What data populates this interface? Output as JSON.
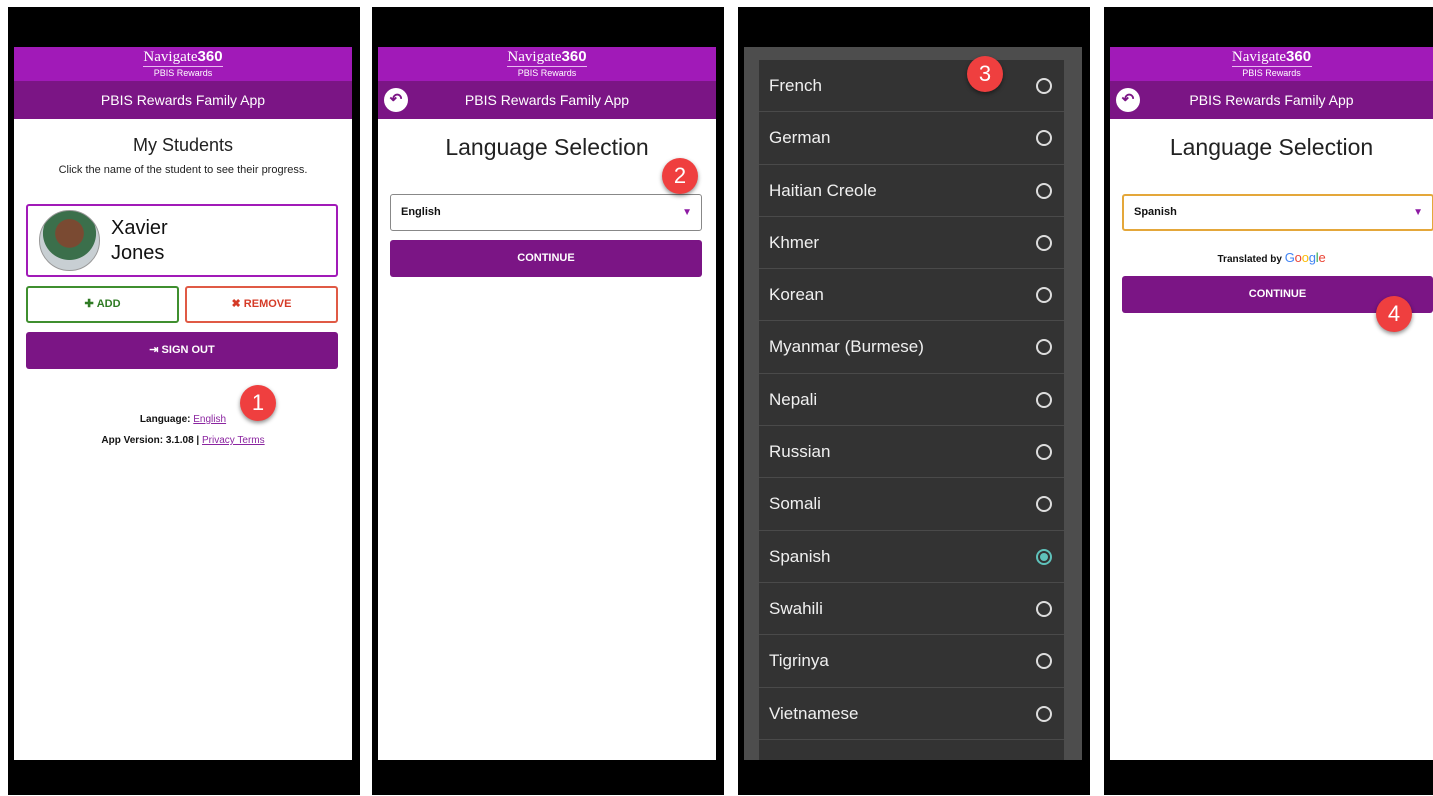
{
  "brand": {
    "name_light": "Navigate",
    "name_bold": "360",
    "subtitle": "PBIS Rewards"
  },
  "app_title": "PBIS Rewards Family App",
  "screen1": {
    "title": "My Students",
    "subtitle": "Click the name of the student to see their progress.",
    "student": {
      "first": "Xavier",
      "last": "Jones"
    },
    "add_label": "ADD",
    "add_icon": "plus-icon",
    "remove_label": "REMOVE",
    "remove_icon": "x-icon",
    "signout_label": "SIGN OUT",
    "signout_icon": "sign-out-icon",
    "language_label": "Language",
    "language_value": "English",
    "version_label": "App Version",
    "version_value": "3.1.08",
    "privacy_link": "Privacy Terms"
  },
  "screen2": {
    "title": "Language Selection",
    "selected": "English",
    "continue_label": "CONTINUE"
  },
  "screen3": {
    "languages": [
      "French",
      "German",
      "Haitian Creole",
      "Khmer",
      "Korean",
      "Myanmar (Burmese)",
      "Nepali",
      "Russian",
      "Somali",
      "Spanish",
      "Swahili",
      "Tigrinya",
      "Vietnamese"
    ],
    "selected": "Spanish"
  },
  "screen4": {
    "title": "Language Selection",
    "selected": "Spanish",
    "translated_by": "Translated by",
    "google": [
      "G",
      "o",
      "o",
      "g",
      "l",
      "e"
    ],
    "continue_label": "CONTINUE"
  },
  "badges": [
    "1",
    "2",
    "3",
    "4"
  ],
  "colors": {
    "brand_purple": "#a11ab8",
    "appbar_purple": "#7b1585",
    "add_green": "#2f7b24",
    "remove_red": "#d53b27",
    "badge_red": "#ef3f3f",
    "radio_teal": "#5fc2bb"
  }
}
